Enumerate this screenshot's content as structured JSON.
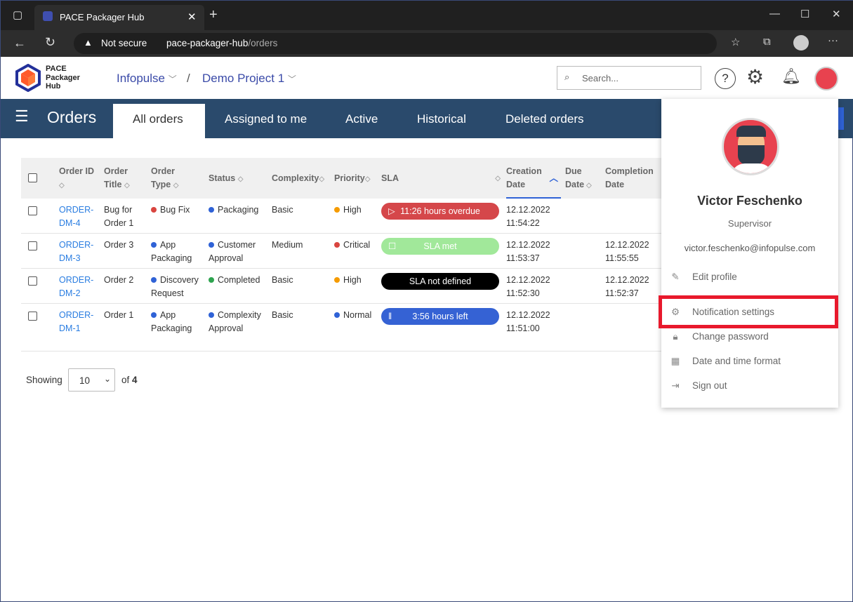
{
  "browser": {
    "tab_title": "PACE Packager Hub",
    "security": "Not secure",
    "url_host": "pace-packager-hub",
    "url_path": "/orders"
  },
  "header": {
    "logo_text": "PACE Packager Hub",
    "logo_lines": [
      "PACE",
      "Packager",
      "Hub"
    ],
    "breadcrumb": [
      "Infopulse",
      "Demo Project 1"
    ],
    "separator": "/",
    "search_placeholder": "Search..."
  },
  "nav": {
    "title": "Orders",
    "tabs": [
      {
        "label": "All orders",
        "active": true
      },
      {
        "label": "Assigned to me"
      },
      {
        "label": "Active"
      },
      {
        "label": "Historical"
      },
      {
        "label": "Deleted orders"
      }
    ]
  },
  "table": {
    "columns": [
      "Order ID",
      "Order Title",
      "Order Type",
      "Status",
      "Complexity",
      "Priority",
      "SLA",
      "Creation Date",
      "Due Date",
      "Completion Date"
    ],
    "sorted_column": "Creation Date",
    "sort_direction": "ascending",
    "rows": [
      {
        "id": "ORDER-DM-4",
        "title": "Bug for Order 1",
        "type": "Bug Fix",
        "type_color": "#d9453f",
        "status": "Packaging",
        "status_color": "#2f62d6",
        "complexity": "Basic",
        "priority": "High",
        "priority_color": "#f59b00",
        "sla": "11:26 hours overdue",
        "sla_color": "#d5474a",
        "sla_icon": "play-icon",
        "creation": "12.12.2022 11:54:22",
        "due": "",
        "completion": ""
      },
      {
        "id": "ORDER-DM-3",
        "title": "Order 3",
        "type": "App Packaging",
        "type_color": "#2f62d6",
        "status": "Customer Approval",
        "status_color": "#2f62d6",
        "complexity": "Medium",
        "priority": "Critical",
        "priority_color": "#d9453f",
        "sla": "SLA met",
        "sla_color": "#a1e89a",
        "sla_icon": "stop-icon",
        "creation": "12.12.2022 11:53:37",
        "due": "",
        "completion": "12.12.2022 11:55:55"
      },
      {
        "id": "ORDER-DM-2",
        "title": "Order 2",
        "type": "Discovery Request",
        "type_color": "#2f62d6",
        "status": "Completed",
        "status_color": "#2ea44f",
        "complexity": "Basic",
        "priority": "High",
        "priority_color": "#f59b00",
        "sla": "SLA not defined",
        "sla_color": "#000000",
        "sla_icon": "",
        "creation": "12.12.2022 11:52:30",
        "due": "",
        "completion": "12.12.2022 11:52:37"
      },
      {
        "id": "ORDER-DM-1",
        "title": "Order 1",
        "type": "App Packaging",
        "type_color": "#2f62d6",
        "status": "Complexity Approval",
        "status_color": "#2f62d6",
        "complexity": "Basic",
        "priority": "Normal",
        "priority_color": "#2f62d6",
        "sla": "3:56 hours left",
        "sla_color": "#3562d4",
        "sla_icon": "pause-icon",
        "creation": "12.12.2022 11:51:00",
        "due": "",
        "completion": ""
      }
    ]
  },
  "pagination": {
    "showing_label": "Showing",
    "page_size": "10",
    "of_label": "of",
    "total": "4"
  },
  "profile": {
    "name": "Victor Feschenko",
    "role": "Supervisor",
    "email": "victor.feschenko@infopulse.com",
    "menu": [
      {
        "label": "Edit profile",
        "icon": "pencil-icon"
      },
      {
        "label": "Notification settings",
        "icon": "gear-icon",
        "highlighted": true
      },
      {
        "label": "Change password",
        "icon": "lock-icon"
      },
      {
        "label": "Date and time format",
        "icon": "calendar-icon"
      },
      {
        "label": "Sign out",
        "icon": "sign-out-icon"
      }
    ]
  },
  "colors": {
    "nav": "#2a4a6c",
    "link": "#2a7de1",
    "highlight": "#e8192c"
  }
}
